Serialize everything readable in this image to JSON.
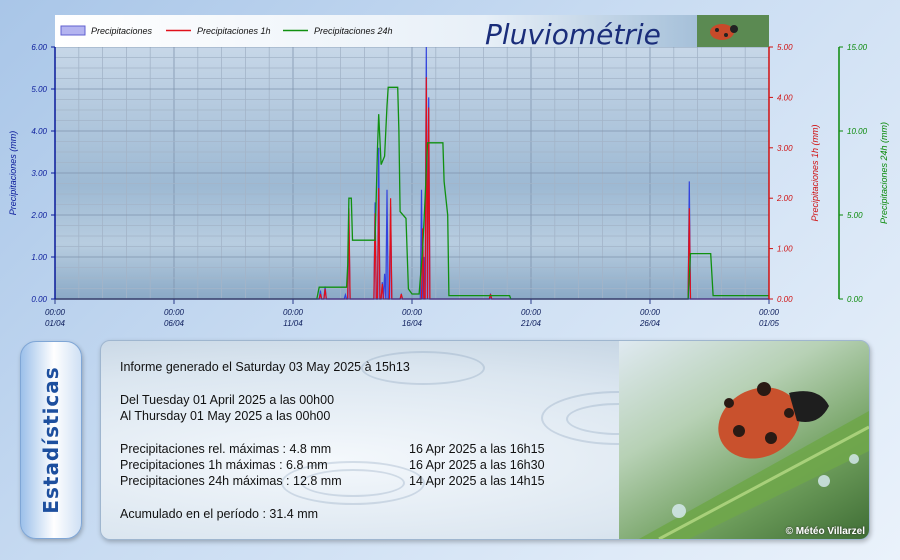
{
  "legend": {
    "items": [
      {
        "label": "Precipitaciones",
        "color": "#7b7bdc"
      },
      {
        "label": "Precipitaciones 1h",
        "color": "#e0101a"
      },
      {
        "label": "Precipitaciones 24h",
        "color": "#109010"
      }
    ]
  },
  "title": "Pluviométrie",
  "colors": {
    "blue": "#3344dd",
    "red": "#e0101a",
    "green": "#109010",
    "axis_blue": "#0a1a9a",
    "axis_red": "#d01010",
    "axis_green": "#0a8a0a"
  },
  "chart_data": {
    "type": "line",
    "x_ticks": [
      {
        "time": "00:00",
        "date": "01/04"
      },
      {
        "time": "00:00",
        "date": "06/04"
      },
      {
        "time": "00:00",
        "date": "11/04"
      },
      {
        "time": "00:00",
        "date": "16/04"
      },
      {
        "time": "00:00",
        "date": "21/04"
      },
      {
        "time": "00:00",
        "date": "26/04"
      },
      {
        "time": "00:00",
        "date": "01/05"
      }
    ],
    "x_range_days": [
      0,
      30
    ],
    "axes": {
      "left": {
        "label": "Precipitaciones (mm)",
        "ylim": [
          0,
          6
        ],
        "ticks": [
          "0.00",
          "1.00",
          "2.00",
          "3.00",
          "4.00",
          "5.00",
          "6.00"
        ]
      },
      "right1": {
        "label": "Precipitaciones 1h (mm)",
        "ylim": [
          0,
          5
        ],
        "ticks": [
          "0.00",
          "1.00",
          "2.00",
          "3.00",
          "4.00",
          "5.00"
        ]
      },
      "right2": {
        "label": "Precipitaciones 24h (mm)",
        "ylim": [
          0,
          15
        ],
        "ticks": [
          "0.00",
          "5.00",
          "10.00",
          "15.00"
        ]
      }
    },
    "grid": true,
    "series": [
      {
        "name": "Precipitaciones",
        "axis": "left",
        "kind": "spike",
        "points": [
          [
            11.15,
            0.2
          ],
          [
            11.35,
            0.3
          ],
          [
            12.2,
            0.1
          ],
          [
            12.35,
            1.8
          ],
          [
            13.45,
            2.3
          ],
          [
            13.6,
            3.6
          ],
          [
            13.75,
            0.4
          ],
          [
            13.85,
            0.6
          ],
          [
            13.95,
            2.6
          ],
          [
            14.1,
            2.2
          ],
          [
            14.55,
            0.1
          ],
          [
            15.4,
            2.6
          ],
          [
            15.5,
            1.0
          ],
          [
            15.6,
            6.0
          ],
          [
            15.7,
            4.8
          ],
          [
            18.3,
            0.1
          ],
          [
            26.65,
            2.8
          ]
        ]
      },
      {
        "name": "Precipitaciones 1h",
        "axis": "right1",
        "kind": "spike",
        "points": [
          [
            11.15,
            0.1
          ],
          [
            11.35,
            0.2
          ],
          [
            12.35,
            1.8
          ],
          [
            13.45,
            1.7
          ],
          [
            13.6,
            2.2
          ],
          [
            13.75,
            0.3
          ],
          [
            14.1,
            2.0
          ],
          [
            14.55,
            0.1
          ],
          [
            15.45,
            1.4
          ],
          [
            15.6,
            4.4
          ],
          [
            15.7,
            3.8
          ],
          [
            18.3,
            0.1
          ],
          [
            26.65,
            1.8
          ]
        ]
      },
      {
        "name": "Precipitaciones 24h",
        "axis": "right2",
        "points": [
          [
            0,
            0
          ],
          [
            11.0,
            0
          ],
          [
            11.1,
            0.7
          ],
          [
            12.25,
            0.7
          ],
          [
            12.3,
            2.0
          ],
          [
            12.35,
            6.0
          ],
          [
            12.45,
            6.0
          ],
          [
            12.5,
            3.5
          ],
          [
            13.45,
            3.5
          ],
          [
            13.55,
            9.0
          ],
          [
            13.6,
            11.0
          ],
          [
            13.7,
            8.0
          ],
          [
            13.85,
            8.5
          ],
          [
            13.95,
            11.5
          ],
          [
            14.0,
            12.6
          ],
          [
            14.4,
            12.6
          ],
          [
            14.45,
            10.0
          ],
          [
            14.5,
            5.2
          ],
          [
            14.75,
            4.8
          ],
          [
            14.85,
            0.6
          ],
          [
            15.0,
            0.3
          ],
          [
            15.3,
            0.3
          ],
          [
            15.45,
            3.0
          ],
          [
            15.55,
            6.0
          ],
          [
            15.65,
            9.3
          ],
          [
            16.3,
            9.3
          ],
          [
            16.35,
            7.0
          ],
          [
            16.5,
            5.0
          ],
          [
            16.55,
            0.2
          ],
          [
            18.3,
            0.2
          ],
          [
            19.1,
            0.2
          ],
          [
            19.15,
            0
          ],
          [
            26.6,
            0
          ],
          [
            26.7,
            2.7
          ],
          [
            27.55,
            2.7
          ],
          [
            27.65,
            0.2
          ],
          [
            30,
            0.2
          ]
        ]
      }
    ]
  },
  "stats": {
    "tab_label": "Estadísticas",
    "generated": "Informe generado el Saturday 03 May 2025 à 15h13",
    "from": "Del Tuesday 01 April 2025 a las 00h00",
    "to": "Al Thursday 01 May 2025 a las 00h00",
    "rows": [
      {
        "label": "Precipitaciones rel. máximas : 4.8 mm",
        "when": "16 Apr 2025 a las 16h15"
      },
      {
        "label": "Precipitaciones 1h máximas : 6.8 mm",
        "when": "16 Apr 2025 a las 16h30"
      },
      {
        "label": "Precipitaciones 24h máximas : 12.8 mm",
        "when": "14 Apr 2025 a las 14h15"
      }
    ],
    "accumulated": "Acumulado en el período : 31.4 mm",
    "copyright": "© Météo Villarzel"
  }
}
